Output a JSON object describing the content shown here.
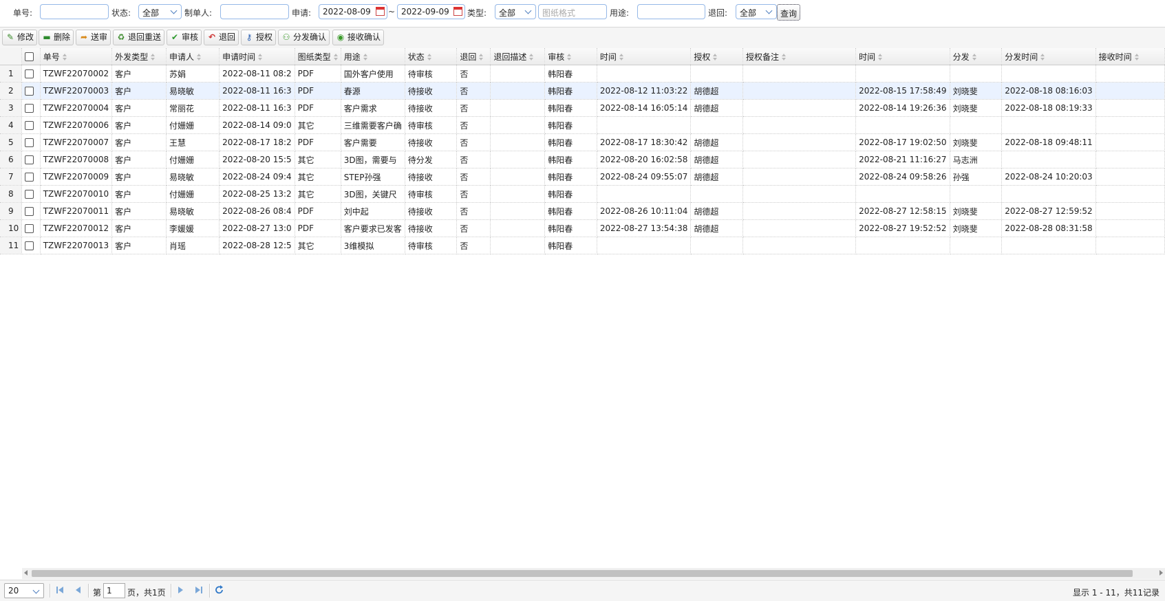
{
  "filters": {
    "order_no_label": "单号:",
    "order_no_value": "",
    "status_label": "状态:",
    "status_value": "全部",
    "maker_label": "制单人:",
    "maker_value": "",
    "apply_label": "申请:",
    "date_from": "2022-08-09",
    "date_sep": "~",
    "date_to": "2022-09-09",
    "type_label": "类型:",
    "type_value": "全部",
    "format_placeholder": "图纸格式",
    "purpose_label": "用途:",
    "purpose_value": "",
    "return_label": "退回:",
    "return_value": "全部",
    "query_label": "查询"
  },
  "toolbar": {
    "edit": "修改",
    "delete": "删除",
    "submit": "送审",
    "resend": "退回重送",
    "review": "审核",
    "return": "退回",
    "authorize": "授权",
    "dispatch_confirm": "分发确认",
    "receive_confirm": "接收确认"
  },
  "columns": [
    "单号",
    "外发类型",
    "申请人",
    "申请时间",
    "图纸类型",
    "用途",
    "状态",
    "退回",
    "退回描述",
    "审核",
    "时间",
    "授权",
    "授权备注",
    "时间",
    "分发",
    "分发时间",
    "接收时间"
  ],
  "rows": [
    {
      "n": "1",
      "id": "TZWF22070002",
      "t": "客户",
      "app": "苏娟",
      "at": "2022-08-11 08:2",
      "dt": "PDF",
      "use": "国外客户使用",
      "st": "待审核",
      "ret": "否",
      "rd": "",
      "rv": "韩阳春",
      "rvt": "",
      "au": "",
      "an": "",
      "aut": "",
      "di": "",
      "dit": "",
      "rt": ""
    },
    {
      "n": "2",
      "id": "TZWF22070003",
      "t": "客户",
      "app": "易晓敏",
      "at": "2022-08-11 16:3",
      "dt": "PDF",
      "use": "春源",
      "st": "待接收",
      "ret": "否",
      "rd": "",
      "rv": "韩阳春",
      "rvt": "2022-08-12 11:03:22",
      "au": "胡德超",
      "an": "",
      "aut": "2022-08-15 17:58:49",
      "di": "刘晓斐",
      "dit": "2022-08-18 08:16:03",
      "rt": ""
    },
    {
      "n": "3",
      "id": "TZWF22070004",
      "t": "客户",
      "app": "常丽花",
      "at": "2022-08-11 16:3",
      "dt": "PDF",
      "use": "客户需求",
      "st": "待接收",
      "ret": "否",
      "rd": "",
      "rv": "韩阳春",
      "rvt": "2022-08-14 16:05:14",
      "au": "胡德超",
      "an": "",
      "aut": "2022-08-14 19:26:36",
      "di": "刘晓斐",
      "dit": "2022-08-18 08:19:33",
      "rt": ""
    },
    {
      "n": "4",
      "id": "TZWF22070006",
      "t": "客户",
      "app": "付姗姗",
      "at": "2022-08-14 09:0",
      "dt": "其它",
      "use": "三维需要客户确",
      "st": "待审核",
      "ret": "否",
      "rd": "",
      "rv": "韩阳春",
      "rvt": "",
      "au": "",
      "an": "",
      "aut": "",
      "di": "",
      "dit": "",
      "rt": ""
    },
    {
      "n": "5",
      "id": "TZWF22070007",
      "t": "客户",
      "app": "王慧",
      "at": "2022-08-17 18:2",
      "dt": "PDF",
      "use": "客户需要",
      "st": "待接收",
      "ret": "否",
      "rd": "",
      "rv": "韩阳春",
      "rvt": "2022-08-17 18:30:42",
      "au": "胡德超",
      "an": "",
      "aut": "2022-08-17 19:02:50",
      "di": "刘晓斐",
      "dit": "2022-08-18 09:48:11",
      "rt": ""
    },
    {
      "n": "6",
      "id": "TZWF22070008",
      "t": "客户",
      "app": "付姗姗",
      "at": "2022-08-20 15:5",
      "dt": "其它",
      "use": "3D图，需要与",
      "st": "待分发",
      "ret": "否",
      "rd": "",
      "rv": "韩阳春",
      "rvt": "2022-08-20 16:02:58",
      "au": "胡德超",
      "an": "",
      "aut": "2022-08-21 11:16:27",
      "di": "马志洲",
      "dit": "",
      "rt": ""
    },
    {
      "n": "7",
      "id": "TZWF22070009",
      "t": "客户",
      "app": "易晓敏",
      "at": "2022-08-24 09:4",
      "dt": "其它",
      "use": "STEP孙强",
      "st": "待接收",
      "ret": "否",
      "rd": "",
      "rv": "韩阳春",
      "rvt": "2022-08-24 09:55:07",
      "au": "胡德超",
      "an": "",
      "aut": "2022-08-24 09:58:26",
      "di": "孙强",
      "dit": "2022-08-24 10:20:03",
      "rt": ""
    },
    {
      "n": "8",
      "id": "TZWF22070010",
      "t": "客户",
      "app": "付姗姗",
      "at": "2022-08-25 13:2",
      "dt": "其它",
      "use": "3D图，关键尺",
      "st": "待审核",
      "ret": "否",
      "rd": "",
      "rv": "韩阳春",
      "rvt": "",
      "au": "",
      "an": "",
      "aut": "",
      "di": "",
      "dit": "",
      "rt": ""
    },
    {
      "n": "9",
      "id": "TZWF22070011",
      "t": "客户",
      "app": "易晓敏",
      "at": "2022-08-26 08:4",
      "dt": "PDF",
      "use": "刘中起",
      "st": "待接收",
      "ret": "否",
      "rd": "",
      "rv": "韩阳春",
      "rvt": "2022-08-26 10:11:04",
      "au": "胡德超",
      "an": "",
      "aut": "2022-08-27 12:58:15",
      "di": "刘晓斐",
      "dit": "2022-08-27 12:59:52",
      "rt": ""
    },
    {
      "n": "10",
      "id": "TZWF22070012",
      "t": "客户",
      "app": "李媛媛",
      "at": "2022-08-27 13:0",
      "dt": "PDF",
      "use": "客户要求已发客",
      "st": "待接收",
      "ret": "否",
      "rd": "",
      "rv": "韩阳春",
      "rvt": "2022-08-27 13:54:38",
      "au": "胡德超",
      "an": "",
      "aut": "2022-08-27 19:52:52",
      "di": "刘晓斐",
      "dit": "2022-08-28 08:31:58",
      "rt": ""
    },
    {
      "n": "11",
      "id": "TZWF22070013",
      "t": "客户",
      "app": "肖瑶",
      "at": "2022-08-28 12:5",
      "dt": "其它",
      "use": "3维模拟",
      "st": "待审核",
      "ret": "否",
      "rd": "",
      "rv": "韩阳春",
      "rvt": "",
      "au": "",
      "an": "",
      "aut": "",
      "di": "",
      "dit": "",
      "rt": ""
    }
  ],
  "pager": {
    "page_size": "20",
    "page_prefix": "第",
    "page_value": "1",
    "page_suffix": "页，共1页",
    "info": "显示 1 - 11，共11记录"
  },
  "colors": {
    "accent": "#95b8e7",
    "selected_row": "#eaf2ff",
    "header_bg": "#f0f0f0"
  }
}
